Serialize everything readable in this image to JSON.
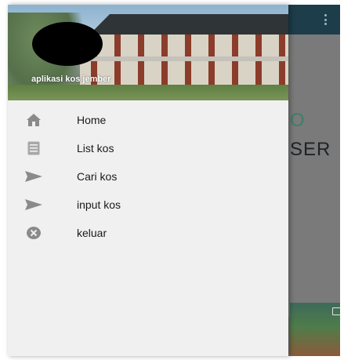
{
  "drawer": {
    "header_title": "aplikasi kos jember"
  },
  "menu": {
    "items": [
      {
        "label": "Home",
        "icon": "home-icon"
      },
      {
        "label": "List kos",
        "icon": "list-icon"
      },
      {
        "label": "Cari kos",
        "icon": "send-icon"
      },
      {
        "label": "input kos",
        "icon": "send-icon"
      },
      {
        "label": "keluar",
        "icon": "close-circle-icon"
      }
    ]
  },
  "background": {
    "heading_1": "O",
    "heading_2": "SER"
  },
  "colors": {
    "toolbar": "#1c3d49",
    "drawer": "#f0f0f0",
    "icon": "#8a8a8a"
  }
}
